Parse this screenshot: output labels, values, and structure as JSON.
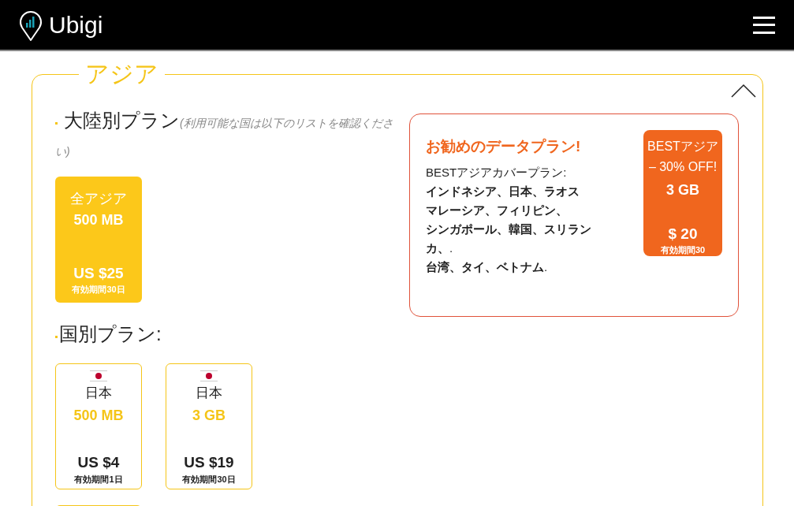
{
  "header": {
    "brand": "Ubigi"
  },
  "region": {
    "title": "アジア",
    "expanded": true,
    "continent_heading": "大陸別プラン",
    "continent_note": "(利用可能な国は以下のリストを確認ください)",
    "continent_plans": [
      {
        "name": "全アジア",
        "data": "500 MB",
        "price": "US $25",
        "validity": "有効期間30日"
      }
    ],
    "country_heading": "国別プラン:",
    "country_plans": [
      {
        "name": "日本",
        "data": "500 MB",
        "price": "US $4",
        "validity": "有効期間1日"
      },
      {
        "name": "日本",
        "data": "3 GB",
        "price": "US $19",
        "validity": "有効期間30日"
      }
    ],
    "recommend": {
      "title": "お勧めのデータプラン!",
      "subtitle": "BESTアジアカバープラン:",
      "lines": [
        "**インドネシア、日本、ラオス**",
        "**マレーシア、フィリピン、**",
        "**シンガポール、韓国、スリラン**",
        "**カ、**.",
        "**台湾、タイ、ベトナム**."
      ],
      "badge": {
        "name_lines": [
          "BESTアジア",
          "– 30% OFF!"
        ],
        "data": "3 GB",
        "price": "$ 20",
        "validity": "有効期間30"
      }
    }
  }
}
